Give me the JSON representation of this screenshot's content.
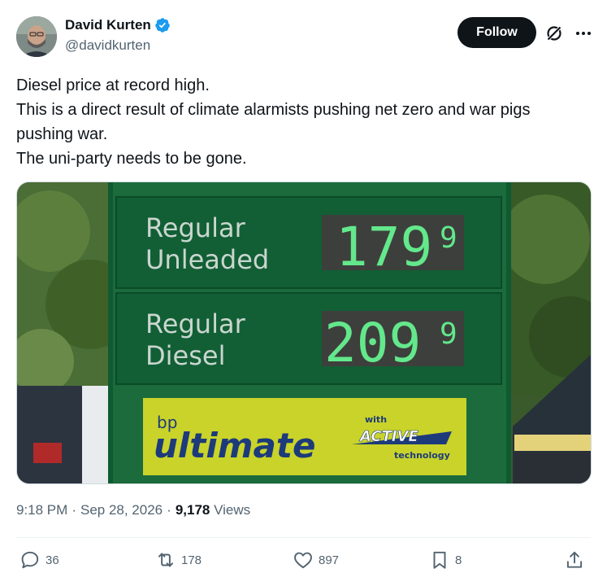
{
  "author": {
    "display_name": "David Kurten",
    "handle": "@davidkurten",
    "verified": true,
    "verified_color": "#1d9bf0"
  },
  "follow_label": "Follow",
  "tweet": {
    "lines": [
      "Diesel price at record high.",
      "This is a direct result of climate alarmists pushing net zero and war pigs",
      "pushing war.",
      "The uni-party needs to be gone."
    ]
  },
  "media": {
    "sign": {
      "row1_label_1": "Regular",
      "row1_label_2": "Unleaded",
      "row1_price": "179",
      "row1_decimal": "9",
      "row2_label_1": "Regular",
      "row2_label_2": "Diesel",
      "row2_price": "209",
      "row2_decimal": "9",
      "brand": "bp",
      "product": "ultimate",
      "badge_with": "with",
      "badge_active": "ACTIVE",
      "badge_technology": "technology"
    }
  },
  "meta": {
    "time": "9:18 PM",
    "date": "Sep 28, 2026",
    "views_count": "9,178",
    "views_label": "Views"
  },
  "actions": {
    "replies": "36",
    "reposts": "178",
    "likes": "897",
    "bookmarks": "8"
  }
}
